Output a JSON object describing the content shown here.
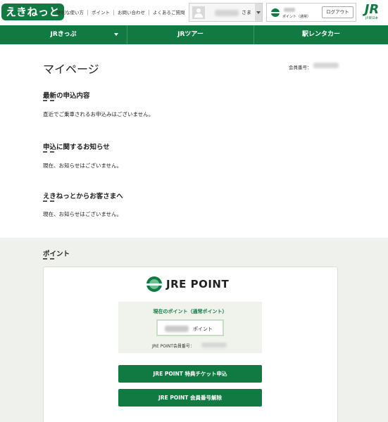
{
  "header": {
    "logo_text": "えきねっと",
    "nav_links": [
      "便利な使い方",
      "ポイント",
      "お問い合わせ",
      "よくあるご質問"
    ],
    "user_suffix": "さま",
    "point_label": "ポイント（通常）",
    "logout_label": "ログアウト",
    "jr_mark": "JR",
    "jr_sub": "JR東日本"
  },
  "green_nav": {
    "items": [
      "JRきっぷ",
      "JRツアー",
      "駅レンタカー"
    ]
  },
  "main": {
    "title": "マイページ",
    "member_label": "会員番号：",
    "sections": [
      {
        "heading": "最新の申込内容",
        "text": "直近でご乗車されるお申込みはございません。"
      },
      {
        "heading": "申込に関するお知らせ",
        "text": "現在、お知らせはございません。"
      },
      {
        "heading": "えきねっとからお客さまへ",
        "text": "現在、お知らせはございません。"
      }
    ]
  },
  "points": {
    "heading": "ポイント",
    "brand": "JRE POINT",
    "current_label": "現在のポイント（通常ポイント）",
    "unit": "ポイント",
    "member_label": "JRE POINT会員番号：",
    "buttons": [
      "JRE POINT 特典チケット申込",
      "JRE POINT 会員番号解除"
    ]
  },
  "colors": {
    "brand_green": "#117a43",
    "point_bg": "#eff2ec"
  }
}
